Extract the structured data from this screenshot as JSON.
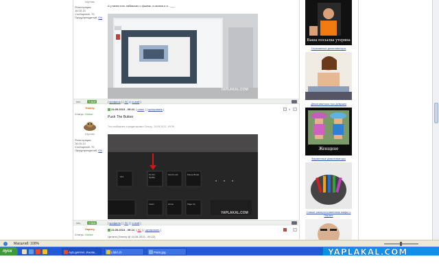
{
  "post1": {
    "username": "Шутник",
    "registration_label": "Регистрация:",
    "registration_date": "16.03.13",
    "messages": "Сообщений: 70",
    "warnings_label": "Предупреждений:",
    "warnings_value": "0%",
    "text": "А у меня есть либмыхис с фокеак, и иконки и а - ___",
    "image_watermark": "YAPLAKAL.COM"
  },
  "sep1": {
    "info_label": "info",
    "rating": "+ 610",
    "links": [
      "профиль",
      "ЛС",
      "e-mail"
    ]
  },
  "post2": {
    "username": "Gomzy",
    "status_label": "Статус:",
    "status_value": "Online",
    "rank": "Шутник",
    "registration_label": "Регистрация:",
    "registration_date": "16.03.13",
    "messages": "Сообщений: 70",
    "warnings_label": "Предупреждений:",
    "warnings_value": "0%",
    "date": "24.05.2013 - 09:24",
    "link_reply": "ответ",
    "link_quote": "цитировать",
    "text": "Push The Button",
    "edit_note": "Это сообщение отредактировал Gomzy - 24.05.2013 - 09:26",
    "image_watermark": "YAPLAKAL.COM",
    "key_labels": [
      "F12",
      "Prt Scr SysRq",
      "Scroll Lock",
      "Pause Break",
      "Insert",
      "Home",
      "Page Up"
    ]
  },
  "sep2": {
    "info_label": "info",
    "rating": "+ 610",
    "links": [
      "профиль",
      "ЛС",
      "e-mail"
    ]
  },
  "post3": {
    "username": "Харьту",
    "status_label": "Статус:",
    "status_value": "Online",
    "date": "24.05.2013 - 09:24",
    "link_reply": "ЛС",
    "link_quote": "цитировать",
    "line2": "Цитата (Gomzy @ 24.05.2013 - 09:22)"
  },
  "rightcol": {
    "banners": [
      {
        "overlay": "Ваша посылка утеряна",
        "caption": "Отрезанные демотиваторы"
      },
      {
        "overlay": "",
        "caption": "Демотиваторы про девушек"
      },
      {
        "overlay": "Женщине",
        "caption": "Фирменные демотиваторы"
      },
      {
        "overlay": "",
        "caption": "Самые распространенные мифы о Пирате"
      },
      {
        "overlay": "",
        "caption": ""
      }
    ]
  },
  "statusbar": {
    "zoom": "Масштаб: 100%"
  },
  "taskbar": {
    "start_label": "пуск",
    "tasks": [
      "Ау5.деятел..Кнопк...",
      "Lfdkf.ch",
      "Paint.jpg"
    ]
  },
  "watermark": "YAPLAKAL.COM",
  "colors": {
    "taskbar": "#2459d6",
    "start": "#3d9a3a",
    "rating": "#6aa84f",
    "link": "#2a4fa8",
    "username": "#d05a00"
  }
}
